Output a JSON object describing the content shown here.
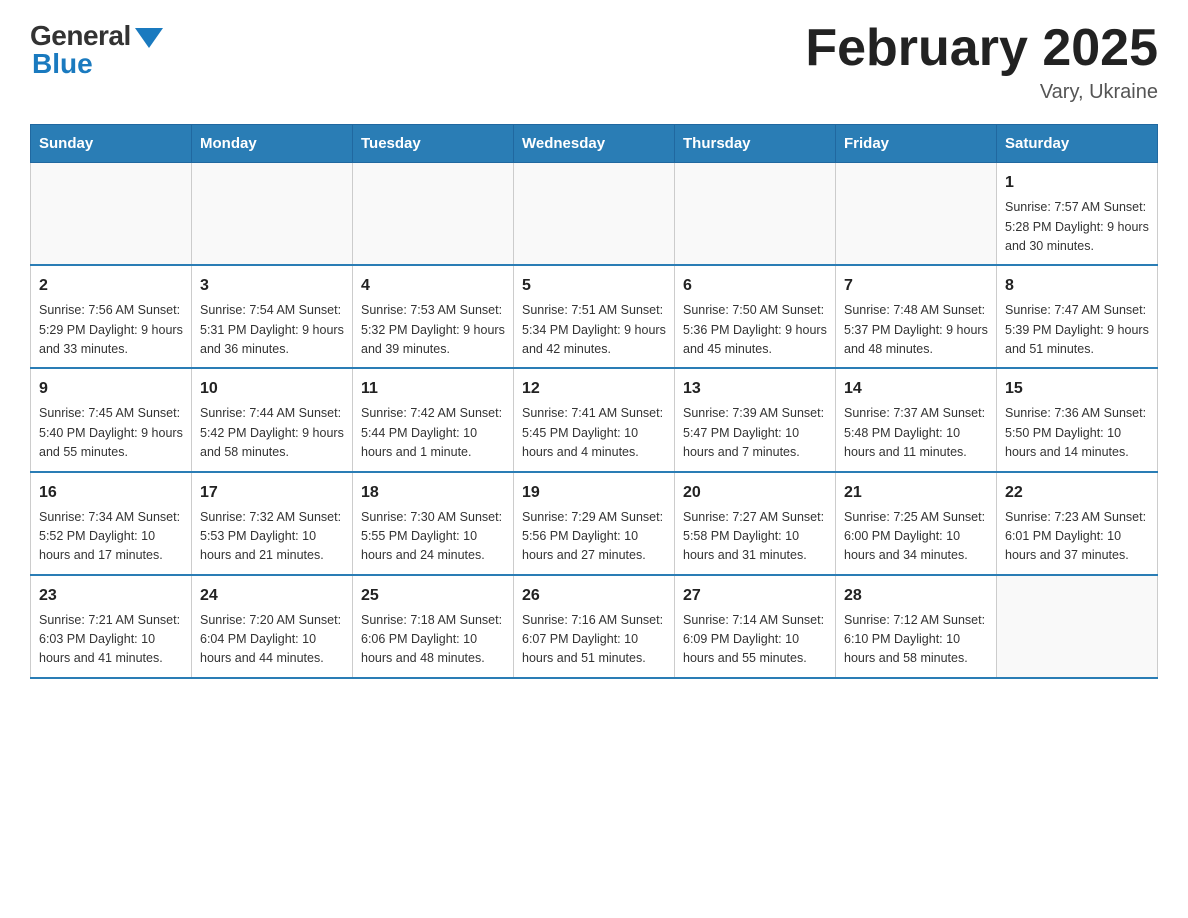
{
  "header": {
    "logo_general": "General",
    "logo_blue": "Blue",
    "month_title": "February 2025",
    "location": "Vary, Ukraine"
  },
  "weekdays": [
    "Sunday",
    "Monday",
    "Tuesday",
    "Wednesday",
    "Thursday",
    "Friday",
    "Saturday"
  ],
  "weeks": [
    [
      {
        "day": "",
        "info": ""
      },
      {
        "day": "",
        "info": ""
      },
      {
        "day": "",
        "info": ""
      },
      {
        "day": "",
        "info": ""
      },
      {
        "day": "",
        "info": ""
      },
      {
        "day": "",
        "info": ""
      },
      {
        "day": "1",
        "info": "Sunrise: 7:57 AM\nSunset: 5:28 PM\nDaylight: 9 hours and 30 minutes."
      }
    ],
    [
      {
        "day": "2",
        "info": "Sunrise: 7:56 AM\nSunset: 5:29 PM\nDaylight: 9 hours and 33 minutes."
      },
      {
        "day": "3",
        "info": "Sunrise: 7:54 AM\nSunset: 5:31 PM\nDaylight: 9 hours and 36 minutes."
      },
      {
        "day": "4",
        "info": "Sunrise: 7:53 AM\nSunset: 5:32 PM\nDaylight: 9 hours and 39 minutes."
      },
      {
        "day": "5",
        "info": "Sunrise: 7:51 AM\nSunset: 5:34 PM\nDaylight: 9 hours and 42 minutes."
      },
      {
        "day": "6",
        "info": "Sunrise: 7:50 AM\nSunset: 5:36 PM\nDaylight: 9 hours and 45 minutes."
      },
      {
        "day": "7",
        "info": "Sunrise: 7:48 AM\nSunset: 5:37 PM\nDaylight: 9 hours and 48 minutes."
      },
      {
        "day": "8",
        "info": "Sunrise: 7:47 AM\nSunset: 5:39 PM\nDaylight: 9 hours and 51 minutes."
      }
    ],
    [
      {
        "day": "9",
        "info": "Sunrise: 7:45 AM\nSunset: 5:40 PM\nDaylight: 9 hours and 55 minutes."
      },
      {
        "day": "10",
        "info": "Sunrise: 7:44 AM\nSunset: 5:42 PM\nDaylight: 9 hours and 58 minutes."
      },
      {
        "day": "11",
        "info": "Sunrise: 7:42 AM\nSunset: 5:44 PM\nDaylight: 10 hours and 1 minute."
      },
      {
        "day": "12",
        "info": "Sunrise: 7:41 AM\nSunset: 5:45 PM\nDaylight: 10 hours and 4 minutes."
      },
      {
        "day": "13",
        "info": "Sunrise: 7:39 AM\nSunset: 5:47 PM\nDaylight: 10 hours and 7 minutes."
      },
      {
        "day": "14",
        "info": "Sunrise: 7:37 AM\nSunset: 5:48 PM\nDaylight: 10 hours and 11 minutes."
      },
      {
        "day": "15",
        "info": "Sunrise: 7:36 AM\nSunset: 5:50 PM\nDaylight: 10 hours and 14 minutes."
      }
    ],
    [
      {
        "day": "16",
        "info": "Sunrise: 7:34 AM\nSunset: 5:52 PM\nDaylight: 10 hours and 17 minutes."
      },
      {
        "day": "17",
        "info": "Sunrise: 7:32 AM\nSunset: 5:53 PM\nDaylight: 10 hours and 21 minutes."
      },
      {
        "day": "18",
        "info": "Sunrise: 7:30 AM\nSunset: 5:55 PM\nDaylight: 10 hours and 24 minutes."
      },
      {
        "day": "19",
        "info": "Sunrise: 7:29 AM\nSunset: 5:56 PM\nDaylight: 10 hours and 27 minutes."
      },
      {
        "day": "20",
        "info": "Sunrise: 7:27 AM\nSunset: 5:58 PM\nDaylight: 10 hours and 31 minutes."
      },
      {
        "day": "21",
        "info": "Sunrise: 7:25 AM\nSunset: 6:00 PM\nDaylight: 10 hours and 34 minutes."
      },
      {
        "day": "22",
        "info": "Sunrise: 7:23 AM\nSunset: 6:01 PM\nDaylight: 10 hours and 37 minutes."
      }
    ],
    [
      {
        "day": "23",
        "info": "Sunrise: 7:21 AM\nSunset: 6:03 PM\nDaylight: 10 hours and 41 minutes."
      },
      {
        "day": "24",
        "info": "Sunrise: 7:20 AM\nSunset: 6:04 PM\nDaylight: 10 hours and 44 minutes."
      },
      {
        "day": "25",
        "info": "Sunrise: 7:18 AM\nSunset: 6:06 PM\nDaylight: 10 hours and 48 minutes."
      },
      {
        "day": "26",
        "info": "Sunrise: 7:16 AM\nSunset: 6:07 PM\nDaylight: 10 hours and 51 minutes."
      },
      {
        "day": "27",
        "info": "Sunrise: 7:14 AM\nSunset: 6:09 PM\nDaylight: 10 hours and 55 minutes."
      },
      {
        "day": "28",
        "info": "Sunrise: 7:12 AM\nSunset: 6:10 PM\nDaylight: 10 hours and 58 minutes."
      },
      {
        "day": "",
        "info": ""
      }
    ]
  ]
}
